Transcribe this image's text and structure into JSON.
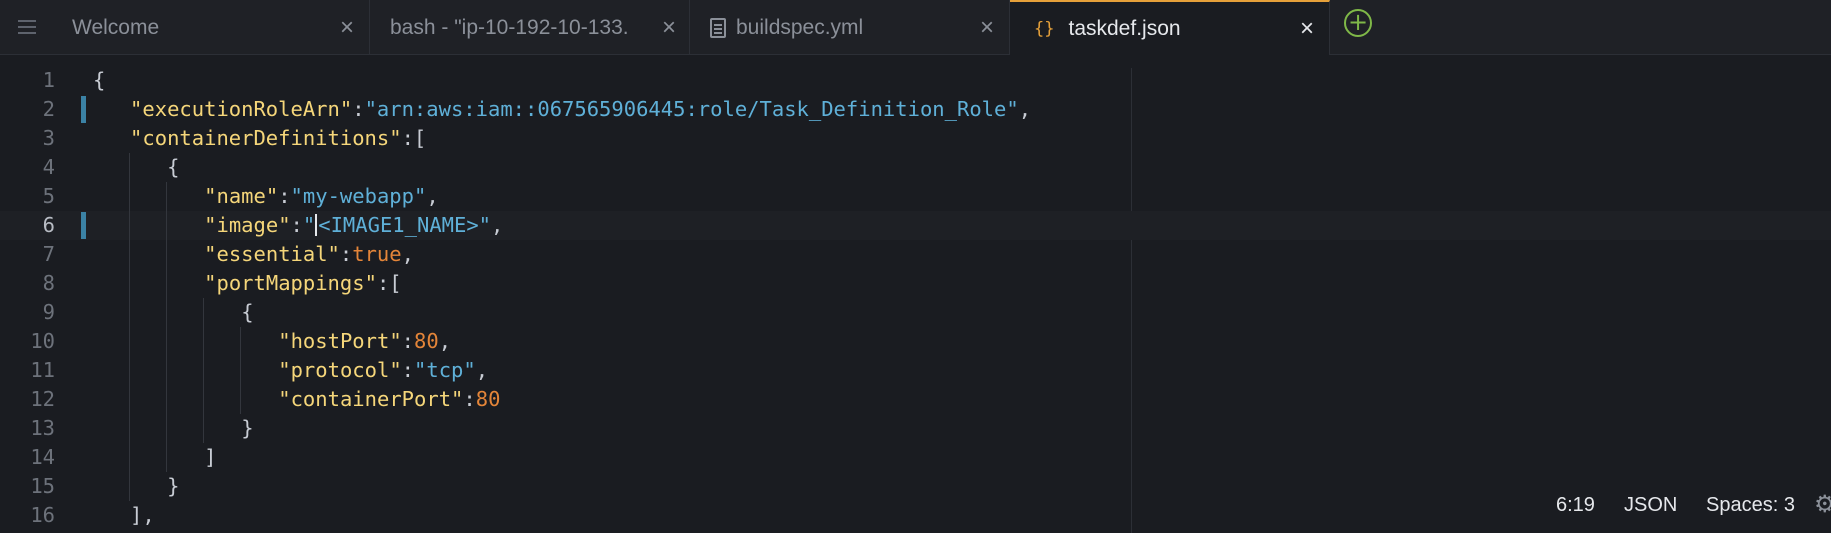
{
  "tabs": [
    {
      "label": "Welcome",
      "close": "×"
    },
    {
      "label": "bash - \"ip-10-192-10-133.",
      "close": "×"
    },
    {
      "label": "buildspec.yml",
      "close": "×"
    },
    {
      "label": "taskdef.json",
      "close": "×",
      "icon": "{}"
    }
  ],
  "add_tab": "+",
  "editor": {
    "line_numbers": [
      "1",
      "2",
      "3",
      "4",
      "5",
      "6",
      "7",
      "8",
      "9",
      "10",
      "11",
      "12",
      "13",
      "14",
      "15",
      "16"
    ],
    "lines": [
      [
        {
          "t": "{",
          "c": "p"
        }
      ],
      [
        {
          "t": "\"executionRoleArn\"",
          "c": "k"
        },
        {
          "t": ":",
          "c": "p"
        },
        {
          "t": "\"arn:aws:iam::067565906445:role/Task_Definition_Role\"",
          "c": "s"
        },
        {
          "t": ",",
          "c": "p"
        }
      ],
      [
        {
          "t": "\"containerDefinitions\"",
          "c": "k"
        },
        {
          "t": ":[",
          "c": "p"
        }
      ],
      [
        {
          "t": "{",
          "c": "p"
        }
      ],
      [
        {
          "t": "\"name\"",
          "c": "k"
        },
        {
          "t": ":",
          "c": "p"
        },
        {
          "t": "\"my-webapp\"",
          "c": "s"
        },
        {
          "t": ",",
          "c": "p"
        }
      ],
      [
        {
          "t": "\"image\"",
          "c": "k"
        },
        {
          "t": ":",
          "c": "p"
        },
        {
          "t": "\"",
          "c": "s"
        },
        {
          "t": "",
          "c": "cursor"
        },
        {
          "t": "<IMAGE1_NAME>\"",
          "c": "s"
        },
        {
          "t": ",",
          "c": "p"
        }
      ],
      [
        {
          "t": "\"essential\"",
          "c": "k"
        },
        {
          "t": ":",
          "c": "p"
        },
        {
          "t": "true",
          "c": "n"
        },
        {
          "t": ",",
          "c": "p"
        }
      ],
      [
        {
          "t": "\"portMappings\"",
          "c": "k"
        },
        {
          "t": ":[",
          "c": "p"
        }
      ],
      [
        {
          "t": "{",
          "c": "p"
        }
      ],
      [
        {
          "t": "\"hostPort\"",
          "c": "k"
        },
        {
          "t": ":",
          "c": "p"
        },
        {
          "t": "80",
          "c": "n"
        },
        {
          "t": ",",
          "c": "p"
        }
      ],
      [
        {
          "t": "\"protocol\"",
          "c": "k"
        },
        {
          "t": ":",
          "c": "p"
        },
        {
          "t": "\"tcp\"",
          "c": "s"
        },
        {
          "t": ",",
          "c": "p"
        }
      ],
      [
        {
          "t": "\"containerPort\"",
          "c": "k"
        },
        {
          "t": ":",
          "c": "p"
        },
        {
          "t": "80",
          "c": "n"
        }
      ],
      [
        {
          "t": "}",
          "c": "p"
        }
      ],
      [
        {
          "t": "]",
          "c": "p"
        }
      ],
      [
        {
          "t": "}",
          "c": "p"
        }
      ],
      [
        {
          "t": "],",
          "c": "p"
        }
      ]
    ],
    "current_line": "6",
    "modified_lines": [
      "2",
      "6"
    ]
  },
  "status": {
    "cursor_position": "6:19",
    "language": "JSON",
    "indentation": "Spaces: 3"
  },
  "icons": {
    "menu": "menu-icon",
    "file": "file-icon",
    "json": "json-file-icon",
    "add": "plus-circle-icon",
    "settings": "gear-icon"
  },
  "colors": {
    "accent": "#e5a03a",
    "key": "#f5d67a",
    "string": "#5fb0d8",
    "number": "#e48539",
    "modified_marker": "#3b82a5",
    "add_icon": "#7fb848"
  }
}
